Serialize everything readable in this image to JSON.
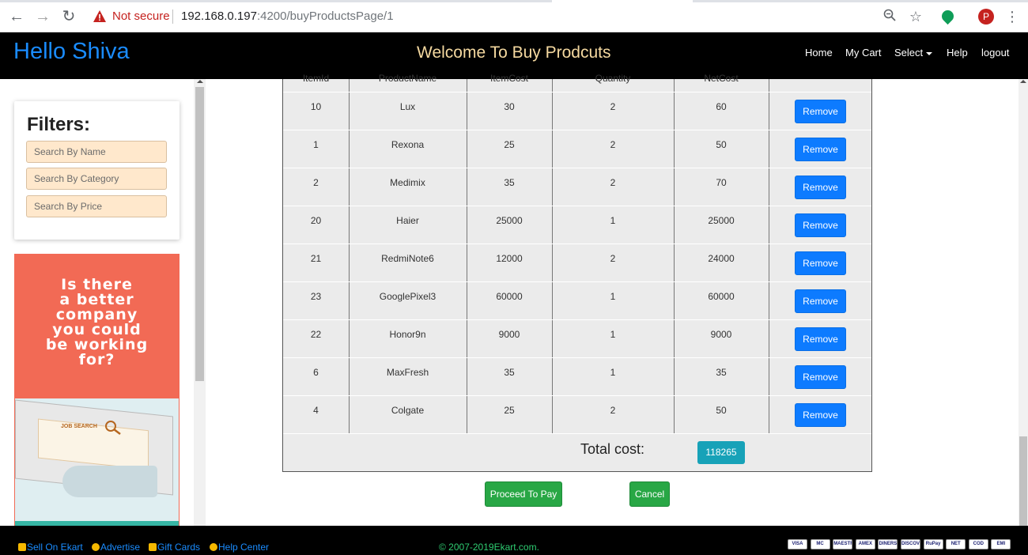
{
  "browser": {
    "security_label": "Not secure",
    "url_host": "192.168.0.197",
    "url_path": ":4200/buyProductsPage/1",
    "profile_initial": "P"
  },
  "header": {
    "greeting": "Hello Shiva",
    "welcome": "Welcome To Buy Prodcuts",
    "nav": {
      "home": "Home",
      "cart": "My Cart",
      "select": "Select",
      "help": "Help",
      "logout": "logout"
    }
  },
  "filters": {
    "title": "Filters:",
    "name_placeholder": "Search By Name",
    "category_placeholder": "Search By Category",
    "price_placeholder": "Search By Price"
  },
  "ad": {
    "line1": "Is there",
    "line2": "a better",
    "line3": "company",
    "line4": "you could",
    "line5": "be working",
    "line6": "for?",
    "screen_text": "JOB SEARCH"
  },
  "table": {
    "headers": [
      "ItemId",
      "ProductName",
      "ItemCost",
      "Quantity",
      "NetCost",
      ""
    ],
    "remove_label": "Remove",
    "rows": [
      {
        "id": "10",
        "name": "Lux",
        "cost": "30",
        "qty": "2",
        "net": "60"
      },
      {
        "id": "1",
        "name": "Rexona",
        "cost": "25",
        "qty": "2",
        "net": "50"
      },
      {
        "id": "2",
        "name": "Medimix",
        "cost": "35",
        "qty": "2",
        "net": "70"
      },
      {
        "id": "20",
        "name": "Haier",
        "cost": "25000",
        "qty": "1",
        "net": "25000"
      },
      {
        "id": "21",
        "name": "RedmiNote6",
        "cost": "12000",
        "qty": "2",
        "net": "24000"
      },
      {
        "id": "23",
        "name": "GooglePixel3",
        "cost": "60000",
        "qty": "1",
        "net": "60000"
      },
      {
        "id": "22",
        "name": "Honor9n",
        "cost": "9000",
        "qty": "1",
        "net": "9000"
      },
      {
        "id": "6",
        "name": "MaxFresh",
        "cost": "35",
        "qty": "1",
        "net": "35"
      },
      {
        "id": "4",
        "name": "Colgate",
        "cost": "25",
        "qty": "2",
        "net": "50"
      }
    ],
    "total_label": "Total cost:",
    "total_value": "118265"
  },
  "actions": {
    "proceed": "Proceed To Pay",
    "cancel": "Cancel"
  },
  "footer": {
    "sell": "Sell On Ekart",
    "advertise": "Advertise",
    "gift": "Gift Cards",
    "help": "Help Center",
    "copyright": "© 2007-2019Ekart.com.",
    "payments": [
      "VISA",
      "MC",
      "MAESTRO",
      "AMEX",
      "DINERS",
      "DISCOVER",
      "RuPay",
      "NET",
      "COD",
      "EMI"
    ]
  },
  "colors": {
    "header_bg": "#000000",
    "greeting": "#1a8cff",
    "remove_button": "#0d7bff",
    "total_badge": "#17a2b8",
    "action_button": "#28a745"
  }
}
